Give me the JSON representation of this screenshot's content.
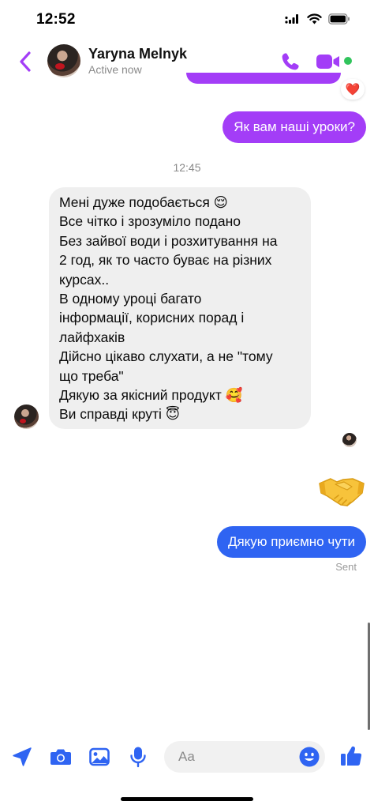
{
  "status_bar": {
    "time": "12:52"
  },
  "header": {
    "contact_name": "Yaryna Melnyk",
    "contact_status": "Active now",
    "accent_color": "#a33df7",
    "online_color": "#31c45c"
  },
  "messages": {
    "previous_reaction": "❤️",
    "outgoing_1": "Як вам наші уроки?",
    "timestamp": "12:45",
    "incoming_lines": [
      "Мені дуже подобається 😌",
      "Все чітко і зрозуміло подано",
      "Без зайвої води і розхитування на",
      "2 год, як то часто буває на різних",
      "курсах..",
      "В одному уроці багато",
      "інформації, корисних порад і",
      "лайфхаків",
      "Дійсно цікаво слухати, а не \"тому",
      "що треба\"",
      "Дякую за якісний продукт 🥰",
      "Ви справді круті 😇"
    ],
    "big_emoji": "🤝",
    "outgoing_2": "Дякую приємно чути",
    "outgoing_2_color": "#2f64f2",
    "delivery_status": "Sent"
  },
  "composer": {
    "placeholder": "Aa",
    "icons": [
      "send-location-icon",
      "camera-icon",
      "gallery-icon",
      "microphone-icon",
      "emoji-icon",
      "thumbs-up-icon"
    ],
    "icon_color": "#2f64f2"
  }
}
